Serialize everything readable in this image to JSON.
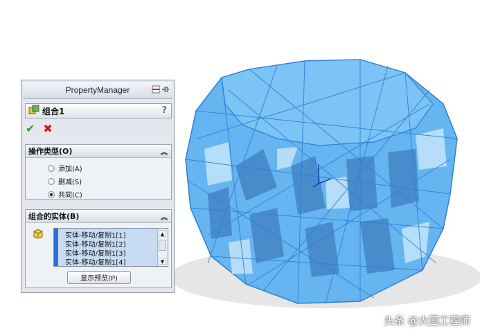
{
  "panel": {
    "title": "PropertyManager",
    "feature_name": "组合1",
    "help": "?",
    "ok_symbol": "✔",
    "cancel_symbol": "✖"
  },
  "operation_type": {
    "header": "操作类型(O)",
    "options": [
      {
        "label": "添加(A)",
        "selected": false
      },
      {
        "label": "删减(S)",
        "selected": false
      },
      {
        "label": "共同(C)",
        "selected": true
      }
    ]
  },
  "bodies": {
    "header": "组合的实体(B)",
    "items": [
      "实体-移动/复制1[1]",
      "实体-移动/复制1[2]",
      "实体-移动/复制1[3]",
      "实体-移动/复制1[4]"
    ],
    "preview_button": "显示预览(P)"
  },
  "watermark": "头条 @大国工程师",
  "colors": {
    "model_fill": "#5aaef0",
    "model_edge": "#2f7fd6",
    "highlight_ellipse": "#e0141a",
    "ok_green": "#2e9d2e",
    "cancel_red": "#d01818"
  },
  "icons": [
    "pushpin-icon",
    "combine-feature-icon",
    "help-icon",
    "ok-check-icon",
    "cancel-x-icon",
    "collapse-chevron-icon",
    "solid-body-icon",
    "scroll-up-icon",
    "scroll-down-icon"
  ]
}
